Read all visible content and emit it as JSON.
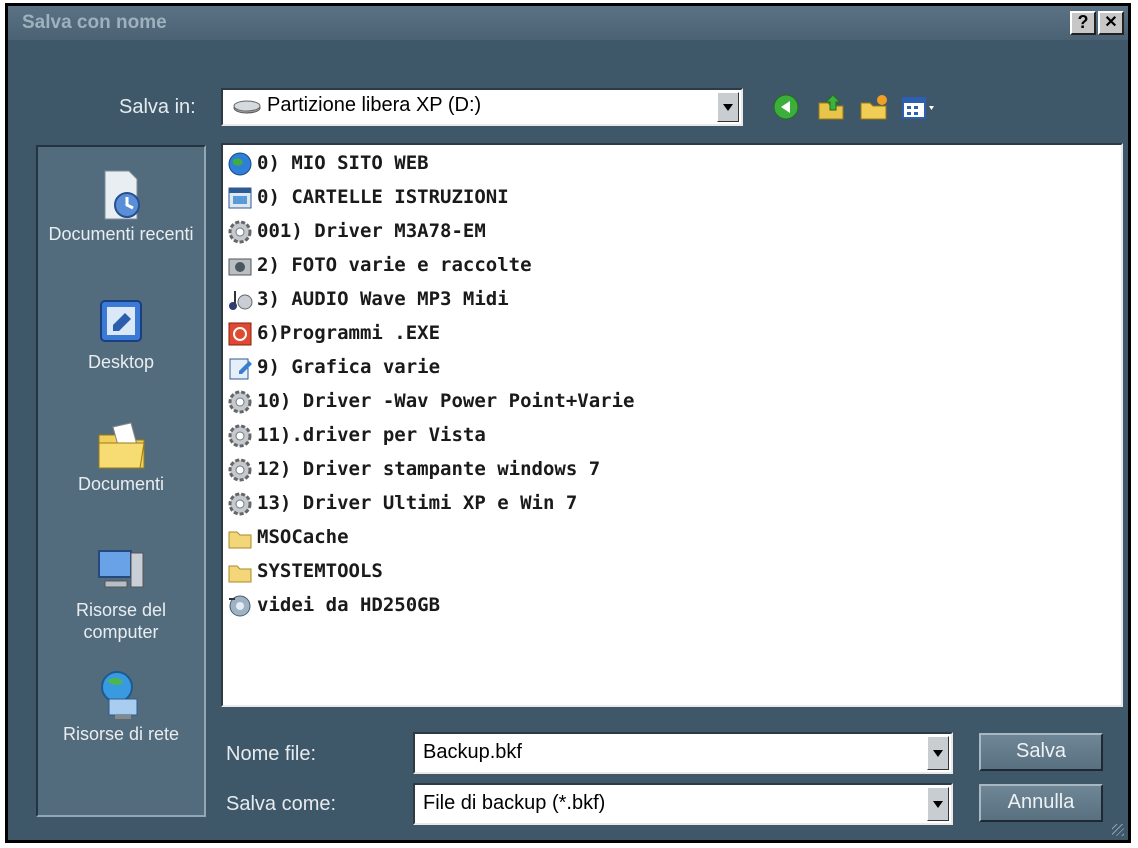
{
  "window": {
    "title": "Salva con nome",
    "help_label": "?",
    "close_label": "✕"
  },
  "save_in": {
    "label": "Salva in:",
    "value": "Partizione libera XP (D:)"
  },
  "toolbar": {
    "icons": [
      "back-icon",
      "up-folder-icon",
      "new-folder-icon",
      "view-menu-icon"
    ]
  },
  "places": [
    {
      "label": "Documenti recenti",
      "icon": "recent-documents-icon"
    },
    {
      "label": "Desktop",
      "icon": "desktop-icon"
    },
    {
      "label": "Documenti",
      "icon": "documents-folder-icon"
    },
    {
      "label": "Risorse del computer",
      "icon": "my-computer-icon"
    },
    {
      "label": "Risorse di rete",
      "icon": "network-icon"
    }
  ],
  "files": [
    {
      "name": "0)  MIO SITO WEB",
      "icon": "globe-icon"
    },
    {
      "name": "0) CARTELLE ISTRUZIONI",
      "icon": "window-folder-icon"
    },
    {
      "name": "001) Driver M3A78-EM",
      "icon": "gear-folder-icon"
    },
    {
      "name": "2) FOTO varie e raccolte",
      "icon": "camera-folder-icon"
    },
    {
      "name": "3) AUDIO Wave MP3 Midi",
      "icon": "music-folder-icon"
    },
    {
      "name": "6)Programmi .EXE",
      "icon": "program-icon"
    },
    {
      "name": "9) Grafica varie",
      "icon": "graphics-folder-icon"
    },
    {
      "name": "10) Driver -Wav Power Point+Varie",
      "icon": "gear-folder-icon"
    },
    {
      "name": "11).driver per Vista",
      "icon": "gear-folder-icon"
    },
    {
      "name": "12) Driver stampante windows 7",
      "icon": "gear-folder-icon"
    },
    {
      "name": "13) Driver Ultimi XP e Win 7",
      "icon": "gear-folder-icon"
    },
    {
      "name": "MSOCache",
      "icon": "folder-icon"
    },
    {
      "name": "SYSTEMTOOLS",
      "icon": "folder-icon"
    },
    {
      "name": "videi da HD250GB",
      "icon": "video-folder-icon"
    }
  ],
  "filename": {
    "label": "Nome file:",
    "value": "Backup.bkf"
  },
  "filetype": {
    "label": "Salva come:",
    "value": "File di backup (*.bkf)"
  },
  "buttons": {
    "save": "Salva",
    "cancel": "Annulla"
  }
}
